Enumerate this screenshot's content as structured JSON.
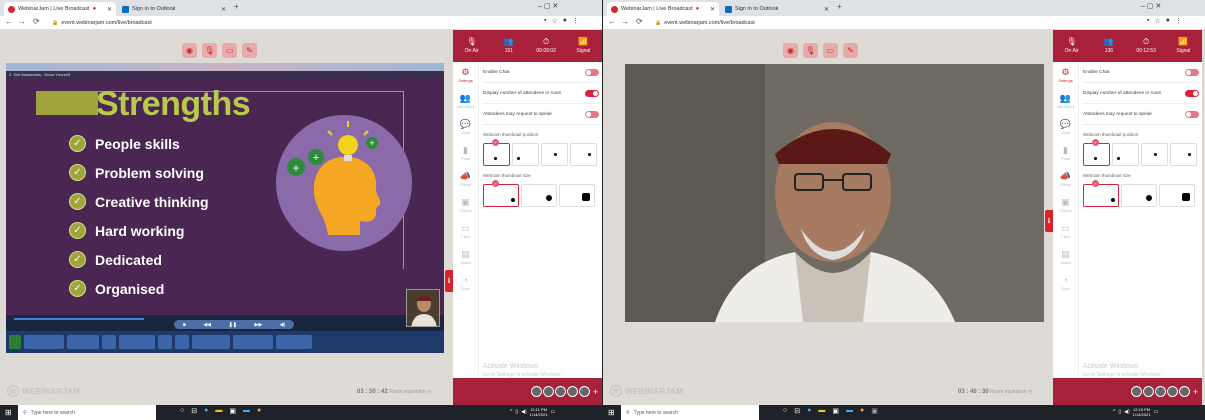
{
  "left": {
    "tabs": [
      {
        "label": "WebinarJam | Live Broadcast",
        "favcolor": "#d8232a"
      },
      {
        "label": "Sign in to Outlook",
        "favcolor": "#0f6cbd"
      }
    ],
    "window_controls": "–   ▢   ✕",
    "url": "event.webinarjam.com/live/broadcast",
    "stats": [
      {
        "icon": "🎙",
        "value": "On Air"
      },
      {
        "icon": "👥",
        "value": "151"
      },
      {
        "icon": "⏱",
        "value": "00:09:02"
      },
      {
        "icon": "📶",
        "value": "Signal"
      }
    ],
    "timer": {
      "value": "03 : 50 : 42",
      "label": "Room expiration"
    },
    "slide": {
      "title": "Strengths",
      "bullets": [
        "People skills",
        "Problem solving",
        "Creative thinking",
        "Hard working",
        "Dedicated",
        "Organised"
      ]
    },
    "taskbar_time": "12:11 PM",
    "taskbar_date": "1/14/2021"
  },
  "right": {
    "tabs": [
      {
        "label": "WebinarJam | Live Broadcast",
        "favcolor": "#d8232a"
      },
      {
        "label": "Sign in to Outlook",
        "favcolor": "#0f6cbd"
      }
    ],
    "window_controls": "–   ▢   ✕",
    "url": "event.webinarjam.com/live/broadcast",
    "stats": [
      {
        "icon": "🎙",
        "value": "On Air"
      },
      {
        "icon": "👥",
        "value": "136"
      },
      {
        "icon": "⏱",
        "value": "00:12:53"
      },
      {
        "icon": "📶",
        "value": "Signal"
      }
    ],
    "timer": {
      "value": "03 : 46 : 30",
      "label": "Room expiration"
    },
    "taskbar_time": "12:15 PM",
    "taskbar_date": "1/14/2021"
  },
  "brand": "WEBINARJAM",
  "nav": [
    "Settings",
    "Attendees",
    "Chat",
    "Polls",
    "Offers",
    "Videos",
    "Files",
    "Slides",
    "Quiz"
  ],
  "settings": {
    "enable_chat": "Enable Chat",
    "display_attendees": "Display number of attendees in room",
    "request_speak": "Attendees may request to speak",
    "thumb_position": "Webcam thumbnail position",
    "thumb_size": "Webcam thumbnail size"
  },
  "activate": {
    "title": "Activate Windows",
    "sub": "Go to Settings to activate Windows."
  },
  "search_placeholder": "Type here to search",
  "colors": {
    "brand_red": "#a8203a",
    "accent": "#d8232a"
  }
}
